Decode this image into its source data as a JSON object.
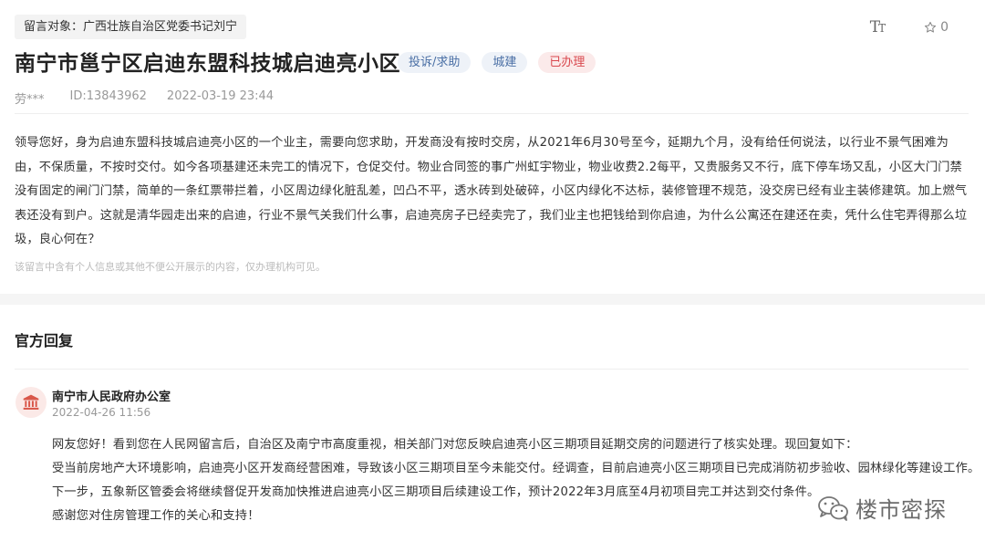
{
  "header": {
    "target": "留言对象：广西壮族自治区党委书记刘宁",
    "font_tool_icon": "font-size-icon",
    "star_count": "0",
    "title": "南宁市邕宁区启迪东盟科技城启迪亮小区",
    "tags": [
      "投诉/求助",
      "城建",
      "已办理"
    ],
    "author": "劳***",
    "id": "ID:13843962",
    "date": "2022-03-19 23:44"
  },
  "message": {
    "body": "领导您好，身为启迪东盟科技城启迪亮小区的一个业主，需要向您求助，开发商没有按时交房，从2021年6月30号至今，延期九个月，没有给任何说法，以行业不景气困难为由，不保质量，不按时交付。如今各项基建还未完工的情况下，仓促交付。物业合同签的事广州虹宇物业，物业收费2.2每平，又贵服务又不行，底下停车场又乱，小区大门门禁没有固定的闸门门禁，简单的一条红票带拦着，小区周边绿化脏乱差，凹凸不平，透水砖到处破碎，小区内绿化不达标，装修管理不规范，没交房已经有业主装修建筑。加上燃气表还没有到户。这就是清华园走出来的启迪，行业不景气关我们什么事，启迪亮房子已经卖完了，我们业主也把钱给到你启迪，为什么公寓还在建还在卖，凭什么住宅弄得那么垃圾，良心何在？",
    "privacy_note": "该留言中含有个人信息或其他不便公开展示的内容，仅办理机构可见。"
  },
  "official": {
    "section_title": "官方回复",
    "office_name": "南宁市人民政府办公室",
    "office_icon": "government-building-icon",
    "time": "2022-04-26 11:56",
    "paragraphs": [
      "网友您好！看到您在人民网留言后，自治区及南宁市高度重视，相关部门对您反映启迪亮小区三期项目延期交房的问题进行了核实处理。现回复如下：",
      "受当前房地产大环境影响，启迪亮小区开发商经营困难，导致该小区三期项目至今未能交付。经调查，目前启迪亮小区三期项目已完成消防初步验收、园林绿化等建设工作。",
      "下一步，五象新区管委会将继续督促开发商加快推进启迪亮小区三期项目后续建设工作，预计2022年3月底至4月初项目完工并达到交付条件。",
      "感谢您对住房管理工作的关心和支持！"
    ]
  },
  "watermark": {
    "text": "楼市密探",
    "icon": "wechat-icon"
  }
}
